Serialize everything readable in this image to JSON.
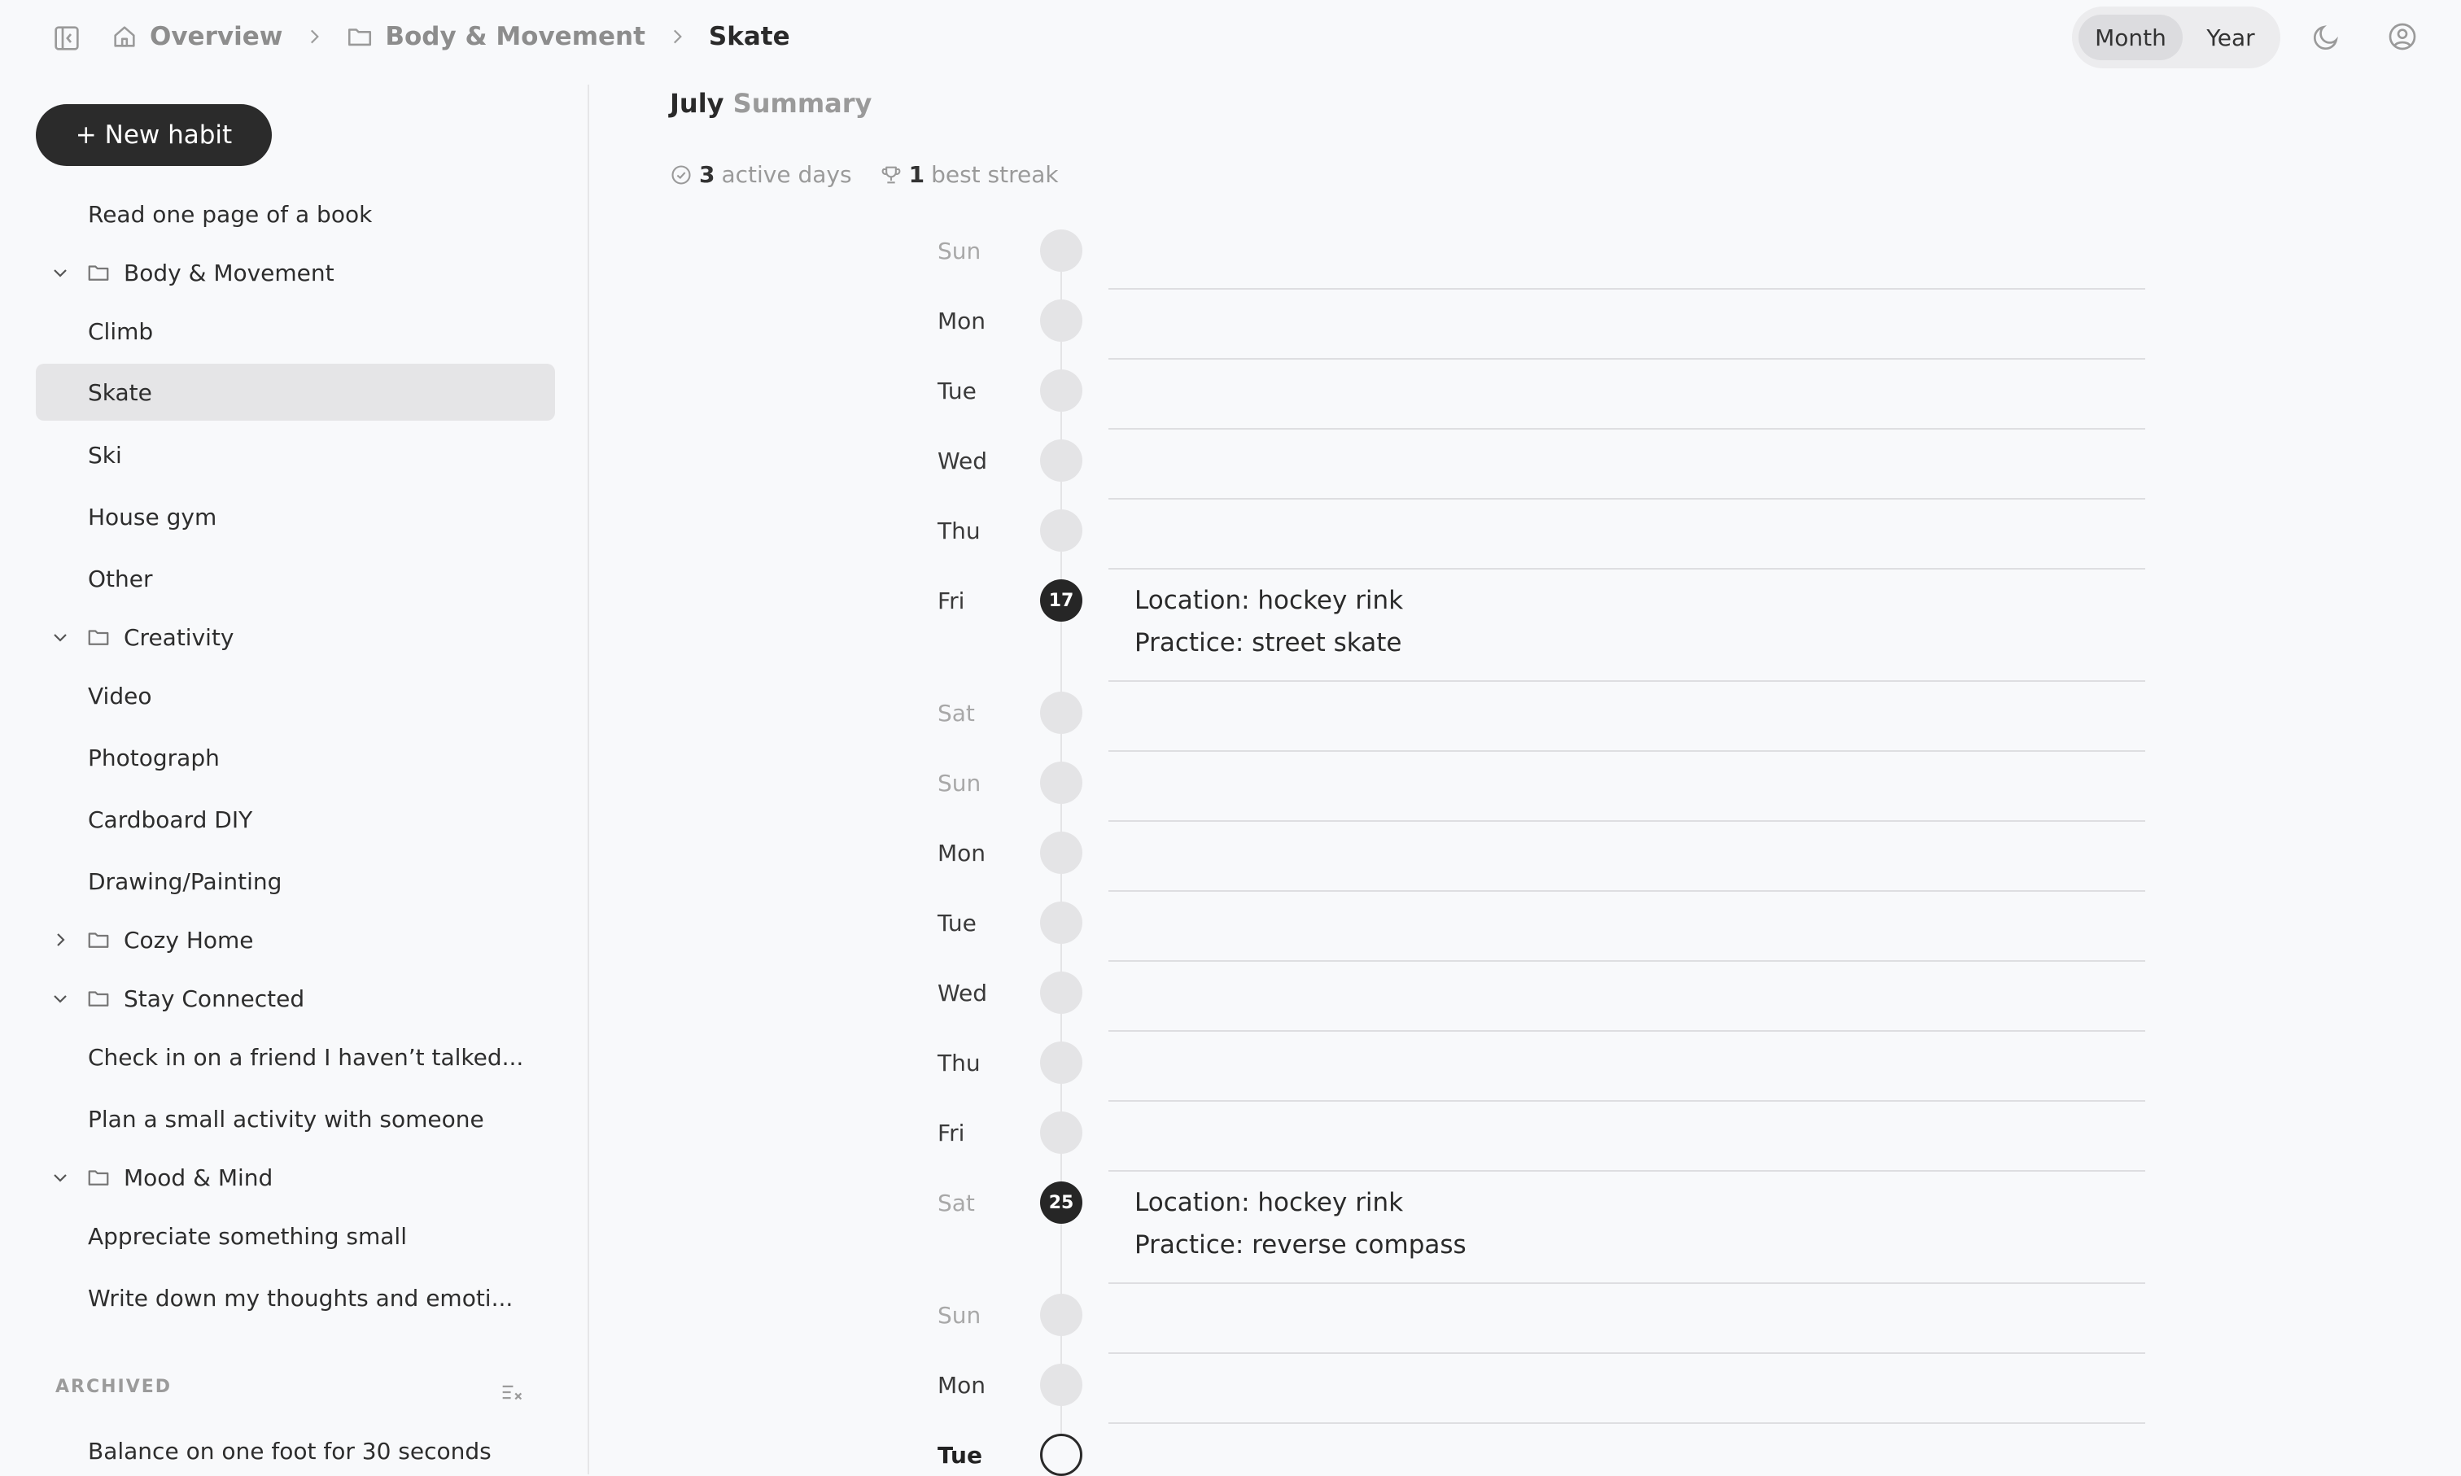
{
  "header": {
    "breadcrumb": [
      {
        "label": "Overview",
        "icon": "home-icon"
      },
      {
        "label": "Body & Movement",
        "icon": "folder-icon"
      },
      {
        "label": "Skate"
      }
    ],
    "view_toggle": {
      "month": "Month",
      "year": "Year",
      "selected": "Month"
    },
    "icons": [
      "sidebar-toggle-icon",
      "moon-icon",
      "user-icon"
    ]
  },
  "sidebar": {
    "new_habit_label": "+ New habit",
    "items": [
      {
        "type": "item",
        "label": "Read one page of a book"
      },
      {
        "type": "group",
        "label": "Body & Movement",
        "expanded": true
      },
      {
        "type": "item",
        "label": "Climb"
      },
      {
        "type": "item",
        "label": "Skate",
        "selected": true
      },
      {
        "type": "item",
        "label": "Ski"
      },
      {
        "type": "item",
        "label": "House gym"
      },
      {
        "type": "item",
        "label": "Other"
      },
      {
        "type": "group",
        "label": "Creativity",
        "expanded": true
      },
      {
        "type": "item",
        "label": "Video"
      },
      {
        "type": "item",
        "label": "Photograph"
      },
      {
        "type": "item",
        "label": "Cardboard DIY"
      },
      {
        "type": "item",
        "label": "Drawing/Painting"
      },
      {
        "type": "group",
        "label": "Cozy Home",
        "expanded": false
      },
      {
        "type": "group",
        "label": "Stay Connected",
        "expanded": true
      },
      {
        "type": "item",
        "label": "Check in on a friend I haven’t talked..."
      },
      {
        "type": "item",
        "label": "Plan a small activity with someone"
      },
      {
        "type": "group",
        "label": "Mood & Mind",
        "expanded": true
      },
      {
        "type": "item",
        "label": "Appreciate something small"
      },
      {
        "type": "item",
        "label": "Write down my thoughts and emoti..."
      }
    ],
    "archived_label": "ARCHIVED",
    "archived_items": [
      {
        "label": "Balance on one foot for 30 seconds"
      }
    ]
  },
  "main": {
    "title_month": "July",
    "title_suffix": "Summary",
    "stats": {
      "active_days": "3",
      "active_days_label": "active days",
      "best_streak": "1",
      "best_streak_label": "best streak"
    },
    "days": [
      {
        "dow": "Sun",
        "muted": true
      },
      {
        "dow": "Mon"
      },
      {
        "dow": "Tue"
      },
      {
        "dow": "Wed"
      },
      {
        "dow": "Thu"
      },
      {
        "dow": "Fri",
        "date": "17",
        "notes": [
          "Location: hockey rink",
          "Practice: street skate"
        ]
      },
      {
        "dow": "Sat",
        "muted": true
      },
      {
        "dow": "Sun",
        "muted": true
      },
      {
        "dow": "Mon"
      },
      {
        "dow": "Tue"
      },
      {
        "dow": "Wed"
      },
      {
        "dow": "Thu"
      },
      {
        "dow": "Fri"
      },
      {
        "dow": "Sat",
        "muted": true,
        "date": "25",
        "notes": [
          "Location: hockey rink",
          "Practice: reverse compass"
        ]
      },
      {
        "dow": "Sun",
        "muted": true
      },
      {
        "dow": "Mon"
      },
      {
        "dow": "Tue",
        "today": true
      }
    ]
  }
}
